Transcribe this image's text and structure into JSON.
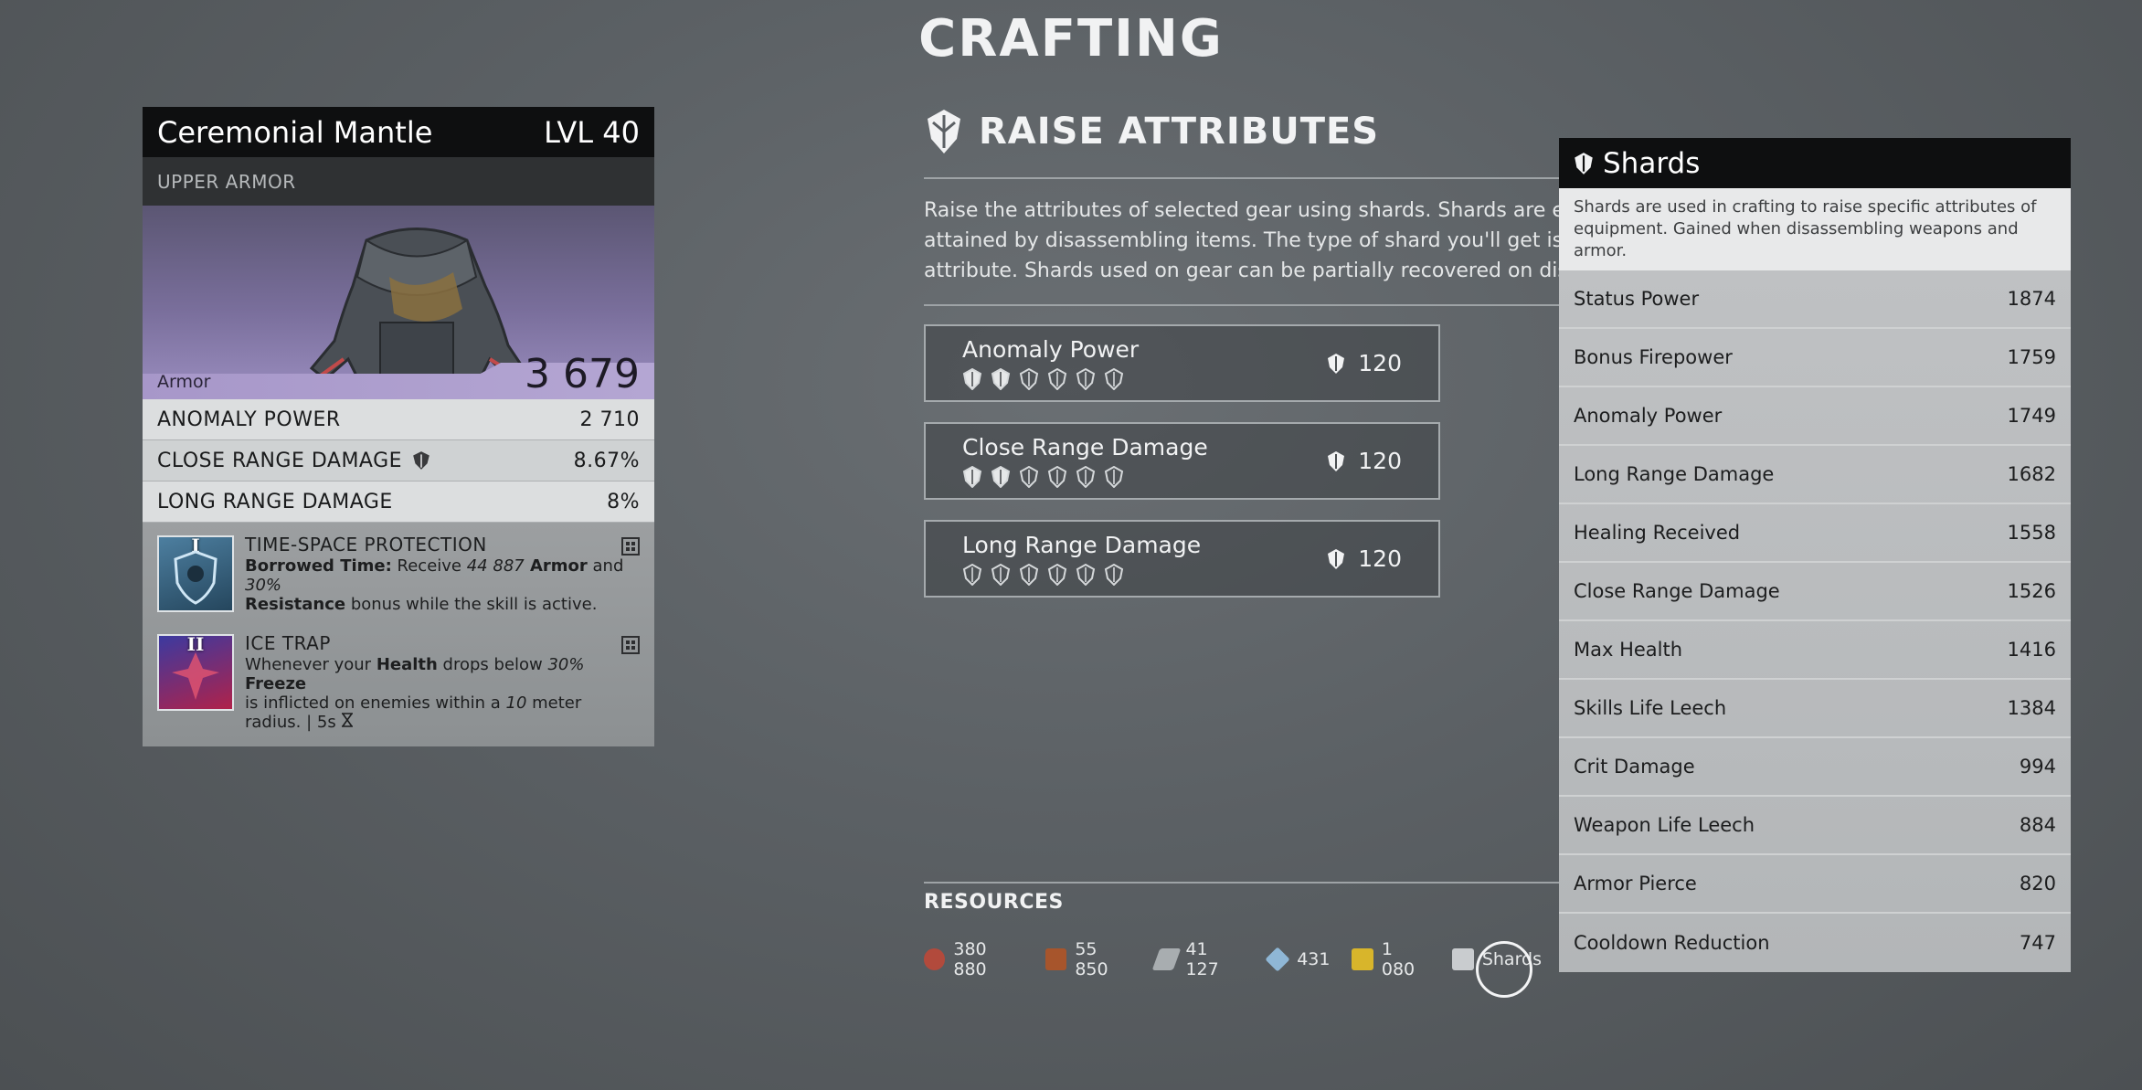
{
  "page_title": "CRAFTING",
  "item": {
    "name": "Ceremonial Mantle",
    "level": "LVL 40",
    "type": "UPPER ARMOR",
    "armor_label": "Armor",
    "armor_value": "3 679",
    "stats": [
      {
        "name": "ANOMALY POWER",
        "value": "2 710"
      },
      {
        "name": "CLOSE RANGE DAMAGE",
        "value": "8.67%",
        "icon": "shard-icon"
      },
      {
        "name": "LONG RANGE DAMAGE",
        "value": "8%"
      }
    ],
    "skills": [
      {
        "roman": "I",
        "title": "TIME-SPACE PROTECTION",
        "bold1": "Borrowed Time:",
        "t1": " Receive ",
        "i1": "44 887",
        "bold2": " Armor",
        "t2": " and ",
        "i2": "30%",
        "bold3": "Resistance",
        "t3": " bonus while the skill is active."
      },
      {
        "roman": "II",
        "title": "ICE TRAP",
        "t1": "Whenever your ",
        "bold1": "Health",
        "t2": " drops below ",
        "i1": "30%",
        "bold2": " Freeze",
        "t3": "is inflicted on enemies within a ",
        "i2": "10",
        "t4": " meter",
        "t5": "radius. | 5s",
        "t5_icon": "hourglass-icon"
      }
    ]
  },
  "raise": {
    "title": "RAISE ATTRIBUTES",
    "desc_lines": [
      "Raise the attributes of selected gear using shards. Shards are exclusive",
      "attained by disassembling items. The type of shard you'll get is indicate",
      "attribute. Shards used on gear can be partially recovered on disassemb"
    ],
    "attributes": [
      {
        "name": "Anomaly Power",
        "cost": "120",
        "filled": 2,
        "total": 6
      },
      {
        "name": "Close Range Damage",
        "cost": "120",
        "filled": 2,
        "total": 6
      },
      {
        "name": "Long Range Damage",
        "cost": "120",
        "filled": 0,
        "total": 6
      }
    ]
  },
  "resources": {
    "title": "RESOURCES",
    "items": [
      {
        "icon": "scrap-icon",
        "value": "380 880",
        "color": "#b24a3c"
      },
      {
        "icon": "leather-icon",
        "value": "55 850",
        "color": "#a7552c"
      },
      {
        "icon": "iron-icon",
        "value": "41 127",
        "color": "#a8adb0"
      },
      {
        "icon": "crystal-icon",
        "value": "431",
        "color": "#8fb7d6"
      },
      {
        "icon": "anomalium-icon",
        "value": "1 080",
        "color": "#d8b52b"
      },
      {
        "icon": "shards-icon",
        "value": "Shards",
        "color": "#c9cccf"
      }
    ]
  },
  "shards": {
    "title": "Shards",
    "desc": "Shards are used in crafting to raise specific attributes of equipment. Gained when disassembling weapons and armor.",
    "rows": [
      {
        "name": "Status Power",
        "value": "1874"
      },
      {
        "name": "Bonus Firepower",
        "value": "1759"
      },
      {
        "name": "Anomaly Power",
        "value": "1749"
      },
      {
        "name": "Long Range Damage",
        "value": "1682"
      },
      {
        "name": "Healing Received",
        "value": "1558"
      },
      {
        "name": "Close Range Damage",
        "value": "1526"
      },
      {
        "name": "Max Health",
        "value": "1416"
      },
      {
        "name": "Skills Life Leech",
        "value": "1384"
      },
      {
        "name": "Crit Damage",
        "value": "994"
      },
      {
        "name": "Weapon Life Leech",
        "value": "884"
      },
      {
        "name": "Armor Pierce",
        "value": "820"
      },
      {
        "name": "Cooldown Reduction",
        "value": "747"
      }
    ]
  }
}
